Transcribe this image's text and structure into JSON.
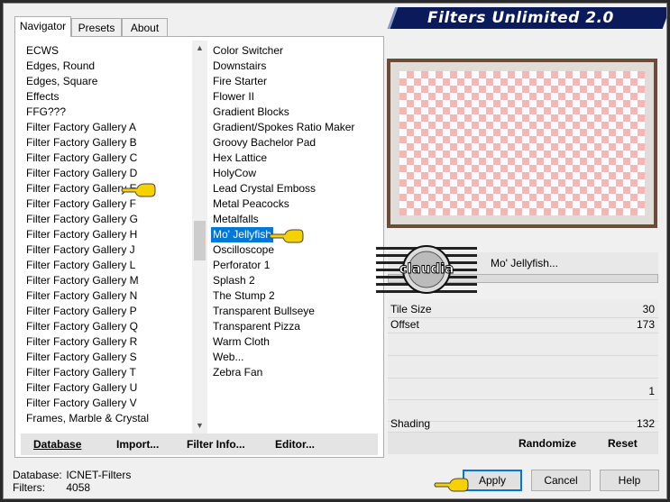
{
  "window": {
    "title": "Filters Unlimited 2.0"
  },
  "tabs": [
    {
      "label": "Navigator",
      "active": true
    },
    {
      "label": "Presets",
      "active": false
    },
    {
      "label": "About",
      "active": false
    }
  ],
  "categories": [
    "ECWS",
    "Edges, Round",
    "Edges, Square",
    "Effects",
    "FFG???",
    "Filter Factory Gallery A",
    "Filter Factory Gallery B",
    "Filter Factory Gallery C",
    "Filter Factory Gallery D",
    "Filter Factory Gallery E",
    "Filter Factory Gallery F",
    "Filter Factory Gallery G",
    "Filter Factory Gallery H",
    "Filter Factory Gallery J",
    "Filter Factory Gallery L",
    "Filter Factory Gallery M",
    "Filter Factory Gallery N",
    "Filter Factory Gallery P",
    "Filter Factory Gallery Q",
    "Filter Factory Gallery R",
    "Filter Factory Gallery S",
    "Filter Factory Gallery T",
    "Filter Factory Gallery U",
    "Filter Factory Gallery V",
    "Frames, Marble & Crystal"
  ],
  "filters": [
    "Color Switcher",
    "Downstairs",
    "Fire Starter",
    "Flower II",
    "Gradient Blocks",
    "Gradient/Spokes Ratio Maker",
    "Groovy Bachelor Pad",
    "Hex Lattice",
    "HolyCow",
    "Lead Crystal Emboss",
    "Metal Peacocks",
    "Metalfalls",
    "Mo' Jellyfish",
    "Oscilloscope",
    "Perforator 1",
    "Splash 2",
    "The Stump 2",
    "Transparent Bullseye",
    "Transparent Pizza",
    "Warm Cloth",
    "Web...",
    "Zebra Fan"
  ],
  "selected_filter": "Mo' Jellyfish",
  "left_buttons": {
    "database": "Database",
    "import": "Import...",
    "filter_info": "Filter Info...",
    "editor": "Editor..."
  },
  "filter_name_display": "Mo' Jellyfish...",
  "logo_text": "claudia",
  "params": [
    {
      "label": "Tile Size",
      "value": "30"
    },
    {
      "label": "Offset",
      "value": "173"
    },
    {
      "label": "",
      "value": ""
    },
    {
      "label": "",
      "value": ""
    },
    {
      "label": "",
      "value": "1"
    },
    {
      "label": "",
      "value": ""
    },
    {
      "label": "Shading",
      "value": "132"
    }
  ],
  "right_buttons": {
    "randomize": "Randomize",
    "reset": "Reset"
  },
  "status": {
    "database_label": "Database:",
    "database_value": "ICNET-Filters",
    "filters_label": "Filters:",
    "filters_value": "4058"
  },
  "dialog_buttons": {
    "apply": "Apply",
    "cancel": "Cancel",
    "help": "Help"
  },
  "colors": {
    "title_banner": "#0a1a5a",
    "selection": "#0078d7",
    "preview_check": "#f7b6b6",
    "pointer": "#f5d100"
  }
}
